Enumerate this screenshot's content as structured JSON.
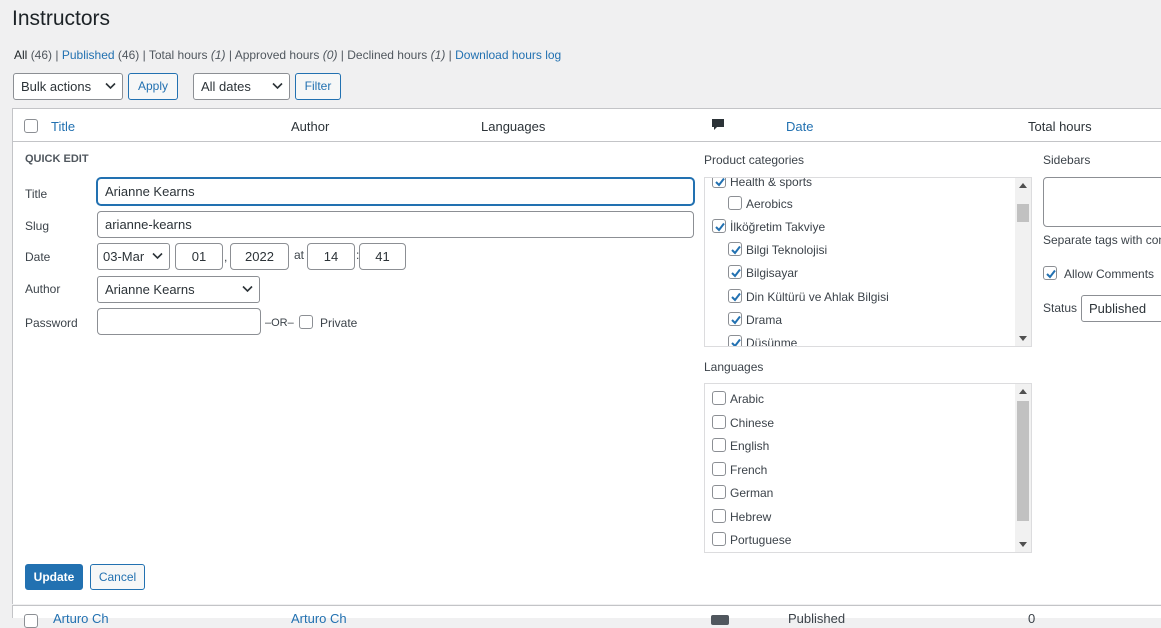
{
  "page": {
    "title": "Instructors"
  },
  "views": {
    "all_label": "All",
    "all_count": "(46)",
    "published_label": "Published",
    "published_count": "(46)",
    "total_hours_label": "Total hours",
    "total_hours_count": "(1)",
    "approved_hours_label": "Approved hours",
    "approved_hours_count": "(0)",
    "declined_hours_label": "Declined hours",
    "declined_hours_count": "(1)",
    "download_label": "Download hours log",
    "sep": "|"
  },
  "toolbar": {
    "bulk_actions": "Bulk actions",
    "apply": "Apply",
    "dates": "All dates",
    "filter": "Filter"
  },
  "columns": {
    "title": "Title",
    "author": "Author",
    "languages": "Languages",
    "comments_icon": "comment-icon",
    "date": "Date",
    "total_hours": "Total hours"
  },
  "quick_edit": {
    "heading": "QUICK EDIT",
    "title_label": "Title",
    "title_value": "Arianne Kearns",
    "slug_label": "Slug",
    "slug_value": "arianne-kearns",
    "date_label": "Date",
    "month": "03-Mar",
    "day": "01",
    "comma": ",",
    "year": "2022",
    "at": "at",
    "hour": "14",
    "colon": ":",
    "minute": "41",
    "author_label": "Author",
    "author_value": "Arianne Kearns",
    "password_label": "Password",
    "password_value": "",
    "or": "–OR–",
    "private_label": "Private",
    "update": "Update",
    "cancel": "Cancel"
  },
  "product_categories": {
    "label": "Product categories",
    "items": [
      {
        "label": "Health & sports",
        "checked": true
      },
      {
        "label": "Aerobics",
        "checked": false
      },
      {
        "label": "İlköğretim Takviye",
        "checked": true
      },
      {
        "label": "Bilgi Teknolojisi",
        "checked": true
      },
      {
        "label": "Bilgisayar",
        "checked": true
      },
      {
        "label": "Din Kültürü ve Ahlak Bilgisi",
        "checked": true
      },
      {
        "label": "Drama",
        "checked": true
      },
      {
        "label": "Düşünme",
        "checked": true
      }
    ]
  },
  "languages": {
    "label": "Languages",
    "items": [
      {
        "label": "Arabic",
        "checked": false
      },
      {
        "label": "Chinese",
        "checked": false
      },
      {
        "label": "English",
        "checked": false
      },
      {
        "label": "French",
        "checked": false
      },
      {
        "label": "German",
        "checked": false
      },
      {
        "label": "Hebrew",
        "checked": false
      },
      {
        "label": "Portuguese",
        "checked": false
      }
    ]
  },
  "sidebars": {
    "label": "Sidebars",
    "tags_hint": "Separate tags with com",
    "allow_comments": "Allow Comments",
    "allow_comments_checked": true,
    "status_label": "Status",
    "status_value": "Published"
  },
  "next_row": {
    "title_fragment": "Arturo Ch",
    "author_fragment": "Arturo Ch",
    "date_fragment": "Published",
    "hours_fragment": "0"
  }
}
